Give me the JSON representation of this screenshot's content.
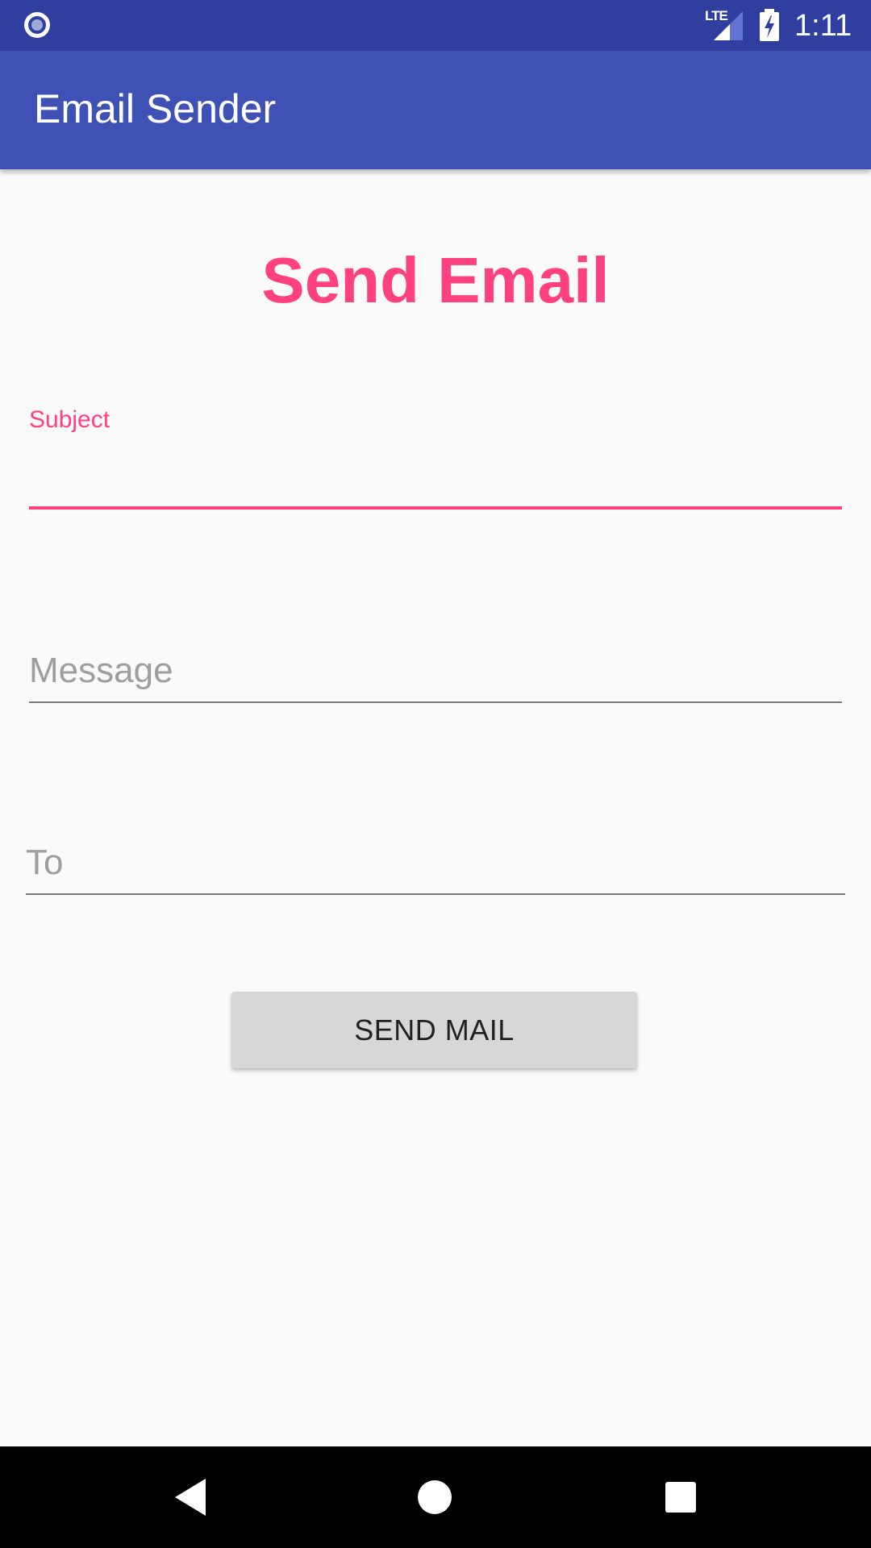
{
  "status_bar": {
    "network_label": "LTE",
    "time": "1:11",
    "left_icon": "record-circle-icon",
    "signal_icon": "signal-icon",
    "battery_icon": "battery-charging-icon"
  },
  "app_bar": {
    "title": "Email Sender"
  },
  "main": {
    "heading": "Send Email",
    "subject": {
      "label": "Subject",
      "value": ""
    },
    "message": {
      "placeholder": "Message",
      "value": ""
    },
    "to": {
      "placeholder": "To",
      "value": ""
    },
    "send_button_label": "SEND MAIL"
  },
  "nav_bar": {
    "back_icon": "back-triangle-icon",
    "home_icon": "home-circle-icon",
    "recents_icon": "recents-square-icon"
  },
  "colors": {
    "status_bar": "#303f9f",
    "app_bar": "#3f51b5",
    "accent": "#ff4081",
    "background": "#fafafa",
    "button": "#d6d7d7"
  }
}
